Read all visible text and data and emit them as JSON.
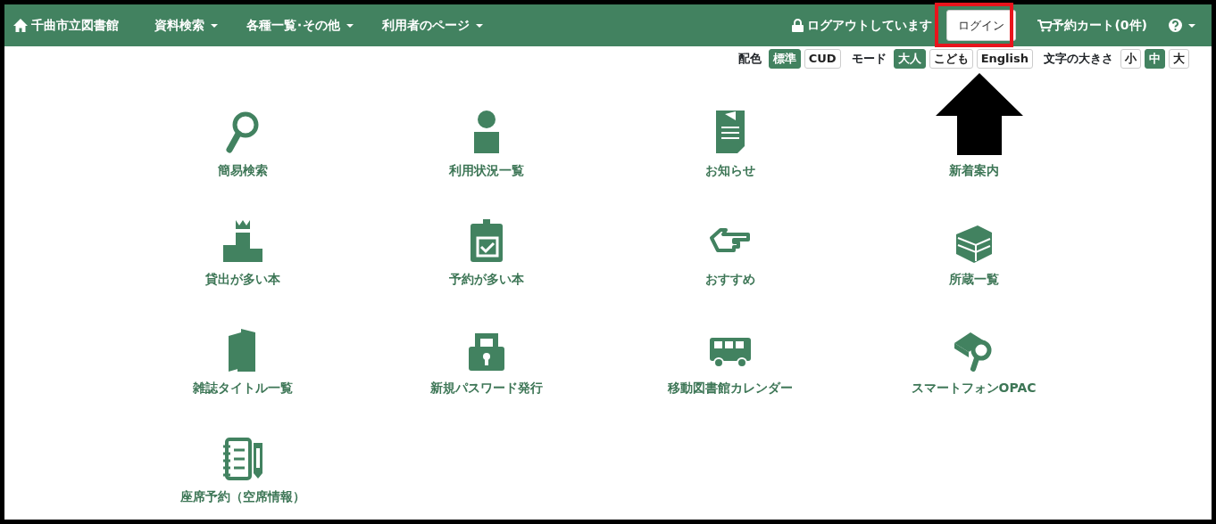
{
  "navbar": {
    "brand": "千曲市立図書館",
    "menus": [
      {
        "label": "資料検索"
      },
      {
        "label": "各種一覧･その他"
      },
      {
        "label": "利用者のページ"
      }
    ],
    "status": "ログアウトしています",
    "login_button": "ログイン",
    "cart": "予約カート(0件)"
  },
  "settings": [
    {
      "label": "配色",
      "options": [
        {
          "label": "標準",
          "selected": true
        },
        {
          "label": "CUD",
          "selected": false
        }
      ]
    },
    {
      "label": "モード",
      "options": [
        {
          "label": "大人",
          "selected": true
        },
        {
          "label": "こども",
          "selected": false
        },
        {
          "label": "English",
          "selected": false
        }
      ]
    },
    {
      "label": "文字の大きさ",
      "options": [
        {
          "label": "小",
          "selected": false
        },
        {
          "label": "中",
          "selected": true
        },
        {
          "label": "大",
          "selected": false
        }
      ]
    }
  ],
  "menu_items": [
    {
      "label": "簡易検索"
    },
    {
      "label": "利用状況一覧"
    },
    {
      "label": "お知らせ"
    },
    {
      "label": "新着案内"
    },
    {
      "label": "貸出が多い本"
    },
    {
      "label": "予約が多い本"
    },
    {
      "label": "おすすめ"
    },
    {
      "label": "所蔵一覧"
    },
    {
      "label": "雑誌タイトル一覧"
    },
    {
      "label": "新規パスワード発行"
    },
    {
      "label": "移動図書館カレンダー"
    },
    {
      "label": "スマートフォンOPAC"
    },
    {
      "label": "座席予約（空席情報）"
    }
  ]
}
